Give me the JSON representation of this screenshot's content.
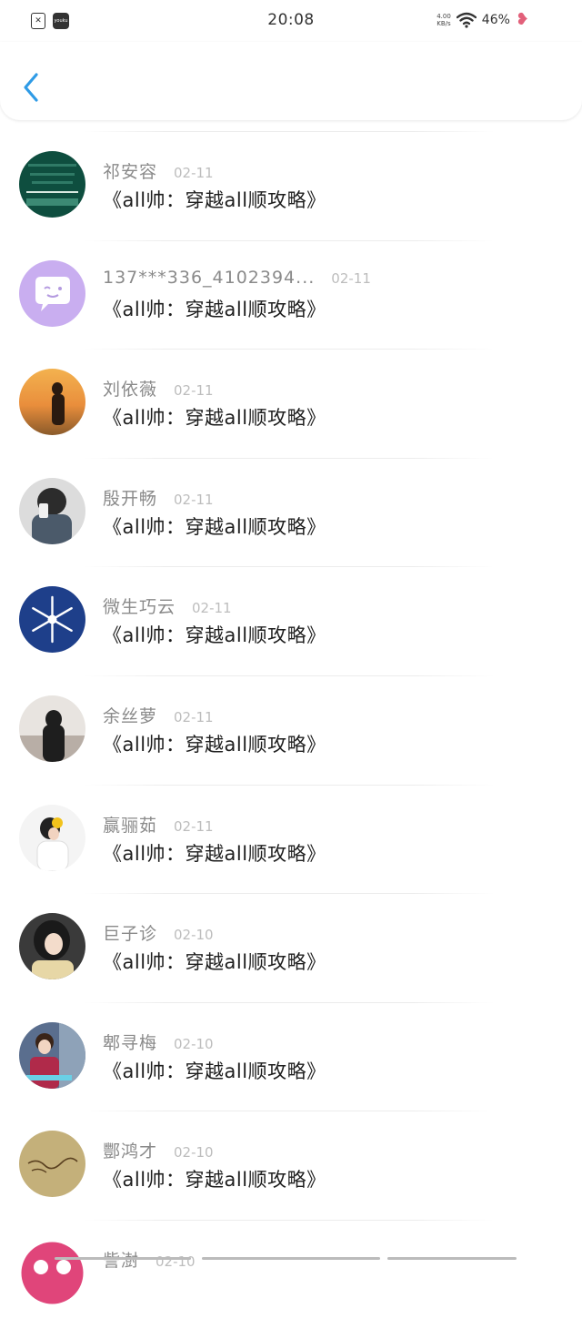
{
  "status_bar": {
    "time": "20:08",
    "speed_value": "4.00",
    "speed_unit": "KB/s",
    "battery": "46%"
  },
  "header": {
    "back_icon": "chevron-left-icon"
  },
  "colors": {
    "accent": "#2f9be6",
    "name_gray": "#8a8a8a",
    "date_gray": "#bdbdbd"
  },
  "entries": [
    {
      "name": "祁安容",
      "date": "02-11",
      "message": "《all帅：穿越all顺攻略》"
    },
    {
      "name": "137***336_4102394...",
      "date": "02-11",
      "message": "《all帅：穿越all顺攻略》"
    },
    {
      "name": "刘依薇",
      "date": "02-11",
      "message": "《all帅：穿越all顺攻略》"
    },
    {
      "name": "殷开畅",
      "date": "02-11",
      "message": "《all帅：穿越all顺攻略》"
    },
    {
      "name": "微生巧云",
      "date": "02-11",
      "message": "《all帅：穿越all顺攻略》"
    },
    {
      "name": "余丝萝",
      "date": "02-11",
      "message": "《all帅：穿越all顺攻略》"
    },
    {
      "name": "赢骊茹",
      "date": "02-11",
      "message": "《all帅：穿越all顺攻略》"
    },
    {
      "name": "巨子诊",
      "date": "02-10",
      "message": "《all帅：穿越all顺攻略》"
    },
    {
      "name": "郫寻梅",
      "date": "02-10",
      "message": "《all帅：穿越all顺攻略》"
    },
    {
      "name": "酆鸿才",
      "date": "02-10",
      "message": "《all帅：穿越all顺攻略》"
    },
    {
      "name": "訾澍",
      "date": "02-10",
      "message": ""
    }
  ]
}
